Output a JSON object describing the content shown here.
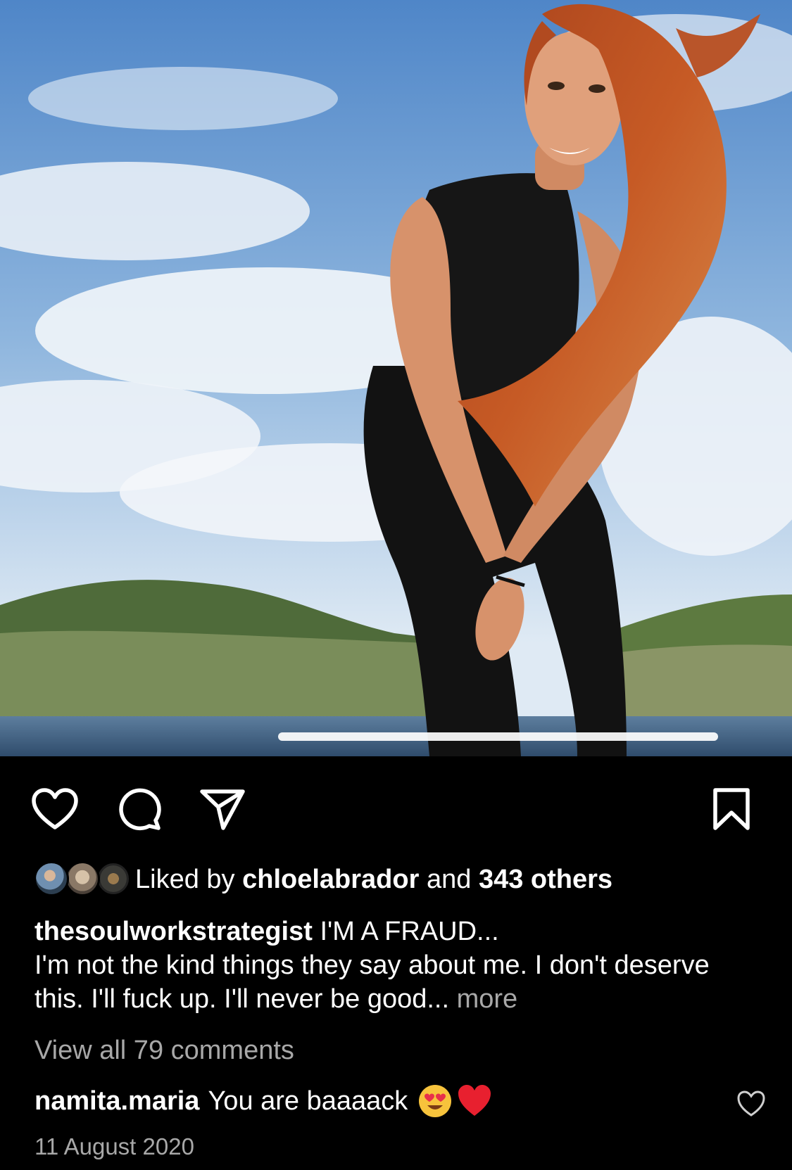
{
  "post": {
    "photo": {
      "description_icon": "photo-of-woman-by-lake"
    },
    "actions": {
      "like_icon": "heart-icon",
      "comment_icon": "comment-bubble-icon",
      "share_icon": "paper-plane-icon",
      "save_icon": "bookmark-icon"
    },
    "likes": {
      "prefix": "Liked by",
      "user": "chloelabrador",
      "conjunction": "and",
      "others": "343 others"
    },
    "caption": {
      "username": "thesoulworkstrategist",
      "text_line1": "I'M A FRAUD...",
      "text_line2": "I'm not the kind things they say about me. I don't deserve this. I'll fuck up. I'll never be good...",
      "more_label": "more"
    },
    "view_all_comments": "View all 79 comments",
    "top_comment": {
      "username": "namita.maria",
      "text": "You are baaaack"
    },
    "date": "11 August 2020"
  },
  "colors": {
    "background": "#000000",
    "text_primary": "#ffffff",
    "text_secondary": "#a8a8a8"
  }
}
